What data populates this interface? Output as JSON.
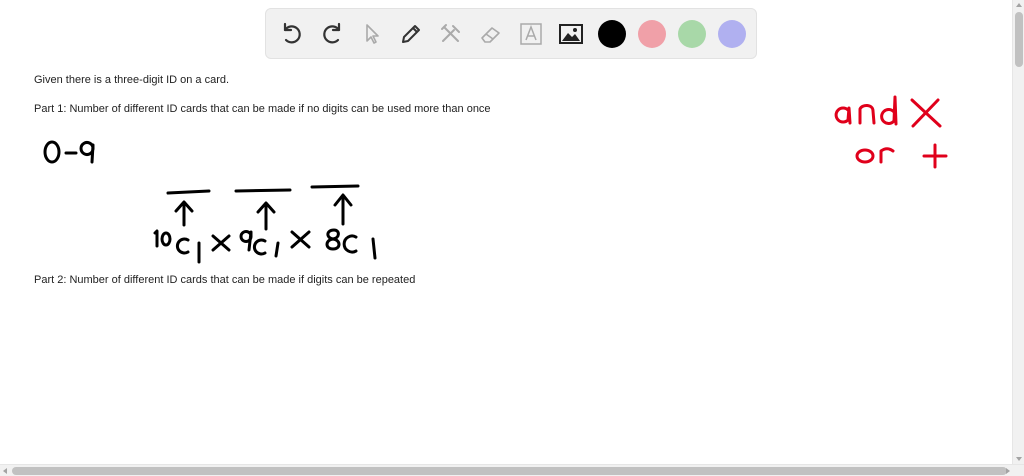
{
  "toolbar": {
    "tools": [
      {
        "name": "undo-icon",
        "enabled": true
      },
      {
        "name": "redo-icon",
        "enabled": true
      },
      {
        "name": "pointer-icon",
        "enabled": false
      },
      {
        "name": "pen-icon",
        "enabled": true
      },
      {
        "name": "tools-icon",
        "enabled": false
      },
      {
        "name": "eraser-icon",
        "enabled": false
      },
      {
        "name": "text-icon",
        "enabled": false
      },
      {
        "name": "image-icon",
        "enabled": true
      }
    ],
    "colors": [
      "#000000",
      "#f0a0a8",
      "#a8d8a8",
      "#b0b0f0"
    ]
  },
  "document": {
    "line1": "Given there is a three-digit ID on a card.",
    "part1": "Part 1: Number of different ID cards that can be made if no digits can be used more than once",
    "part2": "Part 2: Number of different ID cards that can be made if digits can be repeated"
  },
  "handwriting": {
    "digits_range": "0-9",
    "expression": "10C1 × 9C1 × 8C1",
    "note_and": "and ×",
    "note_or": "or +",
    "ink_color": "#000000",
    "note_color": "#e0001b"
  }
}
